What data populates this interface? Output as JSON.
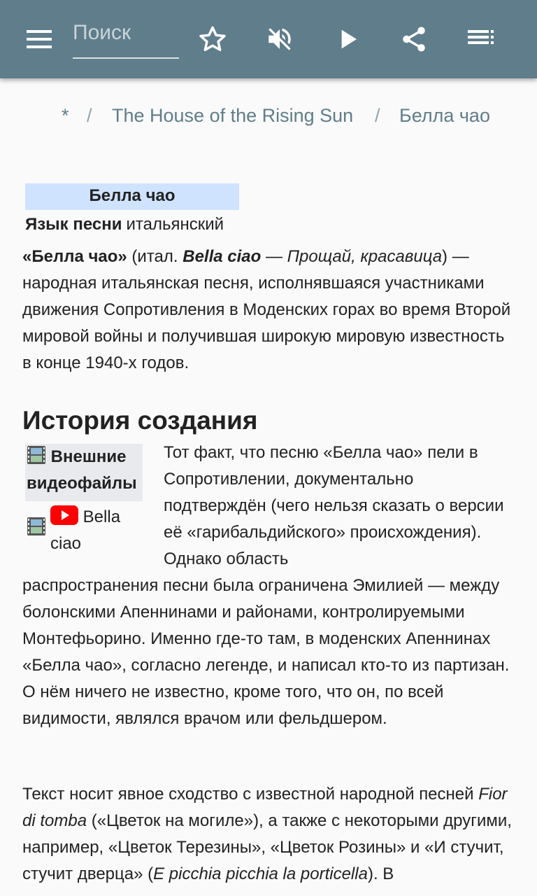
{
  "toolbar": {
    "search_placeholder": "Поиск",
    "icons": [
      "menu-icon",
      "star-icon",
      "volume-off-icon",
      "play-icon",
      "share-icon",
      "playlist-icon"
    ],
    "bg": "#607d8b"
  },
  "breadcrumb": {
    "home": "*",
    "sep1": "/",
    "parent": "The House of the Rising Sun",
    "sep2": "/",
    "current": "Белла чао"
  },
  "infobox": {
    "title": "Белла чао",
    "row_label": "Язык песни",
    "row_value": "итальянский"
  },
  "intro": {
    "bold_title": "«Белла чао»",
    "t1": " (итал. ",
    "orig_title": "Bella ciao",
    "t2": " — ",
    "translation": "Прощай, красавица",
    "t3": ") — народная итальянская песня, исполнявшаяся участниками движения Сопротивления в Моденских горах во время Второй мировой войны и получившая широкую мировую известность в конце 1940-х годов."
  },
  "section": {
    "heading": "История создания",
    "video_box_title": "Внешние видеофайлы",
    "video_link": "Bella ciao",
    "p1_float": "Тот факт, что песню «Белла чао» пели в Сопротивлении, документально подтверждён (чего нельзя сказать о версии её «гарибальдийского» происхождения). Однако область",
    "p1_rest": "распространения песни была ограничена Эмилией — между болонскими Апеннинами и районами, контролируемыми Монтефьорино. Именно где-то там, в моденских Апеннинах «Белла чао», согласно легенде, и написал кто-то из партизан. О нём ничего не известно, кроме того, что он, по всей видимости, являлся врачом или фельдшером.",
    "p2_a": "Текст носит явное сходство с известной народной песней ",
    "p2_fior": "Fior di tomba",
    "p2_b": " («Цветок на могиле»), а также с некоторыми другими, например, «Цветок Терезины», «Цветок Розины» и «И стучит, стучит дверца» (",
    "p2_picchia": "E picchia picchia la porticella",
    "p2_c": "). В"
  }
}
